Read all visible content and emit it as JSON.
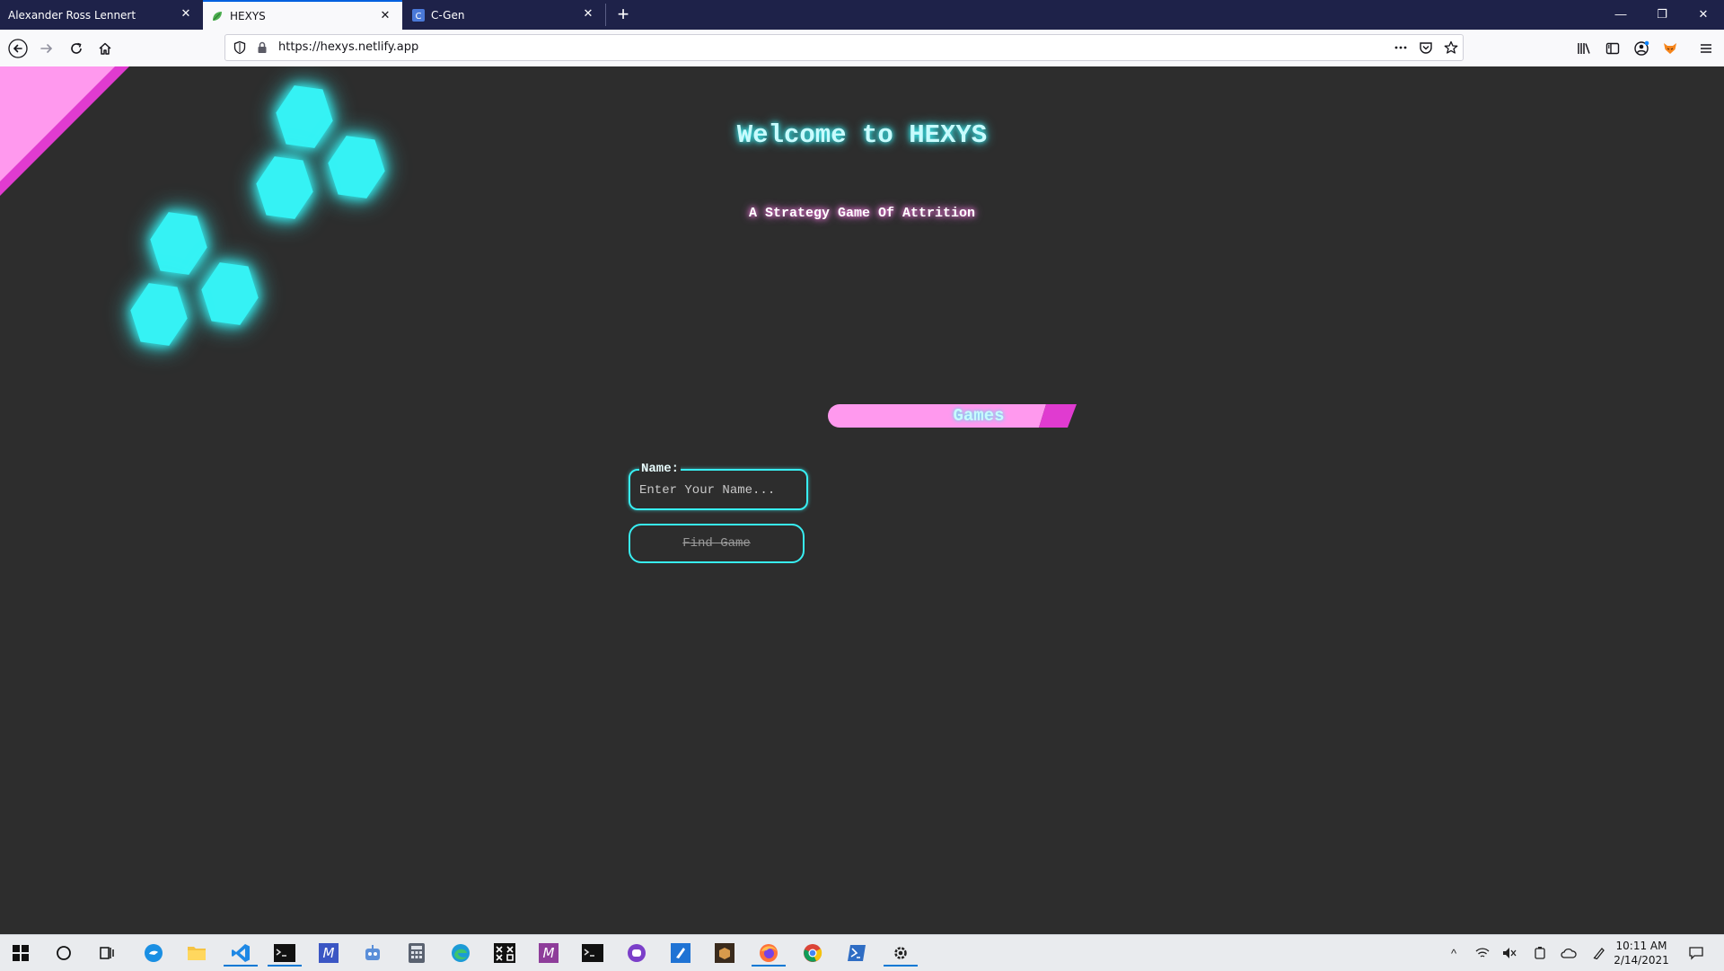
{
  "browser": {
    "tabs": [
      {
        "label": "Alexander Ross Lennert",
        "active": false
      },
      {
        "label": "HEXYS",
        "active": true
      },
      {
        "label": "C-Gen",
        "active": false
      }
    ],
    "url": "https://hexys.netlify.app",
    "icons": {
      "back": "back-arrow-icon",
      "forward": "forward-arrow-icon",
      "reload": "reload-icon",
      "home": "home-icon",
      "shield": "tracking-shield-icon",
      "lock": "lock-icon",
      "more": "more-actions-icon",
      "pocket": "pocket-icon",
      "bookmark": "bookmark-star-icon",
      "library": "library-icon",
      "sidebar": "sidebar-icon",
      "account": "account-icon",
      "extension": "fox-extension-icon",
      "menu": "hamburger-menu-icon"
    }
  },
  "page": {
    "title": "Welcome to HEXYS",
    "subtitle": "A Strategy Game Of Attrition",
    "games_tab_label": "Games",
    "name_label": "Name:",
    "name_value": "",
    "name_placeholder": "Enter Your Name...",
    "find_game_label": "Find Game",
    "colors": {
      "background": "#2d2d2d",
      "cyan": "#38eef2",
      "pink": "#ff99ee",
      "magenta": "#e03bd0"
    }
  },
  "taskbar": {
    "time": "10:11 AM",
    "date": "2/14/2021",
    "apps": [
      "start-icon",
      "search-circle-icon",
      "task-view-icon",
      "chat-bubble-icon",
      "file-explorer-icon",
      "vscode-icon",
      "terminal-icon",
      "m-app-icon",
      "robot-icon",
      "calculator-icon",
      "edge-icon",
      "matrix-icon",
      "m-app-icon-2",
      "terminal-icon-2",
      "purple-app-icon",
      "blue-app-icon",
      "box-app-icon",
      "firefox-icon",
      "chrome-icon",
      "powershell-icon",
      "settings-gear-icon"
    ]
  }
}
